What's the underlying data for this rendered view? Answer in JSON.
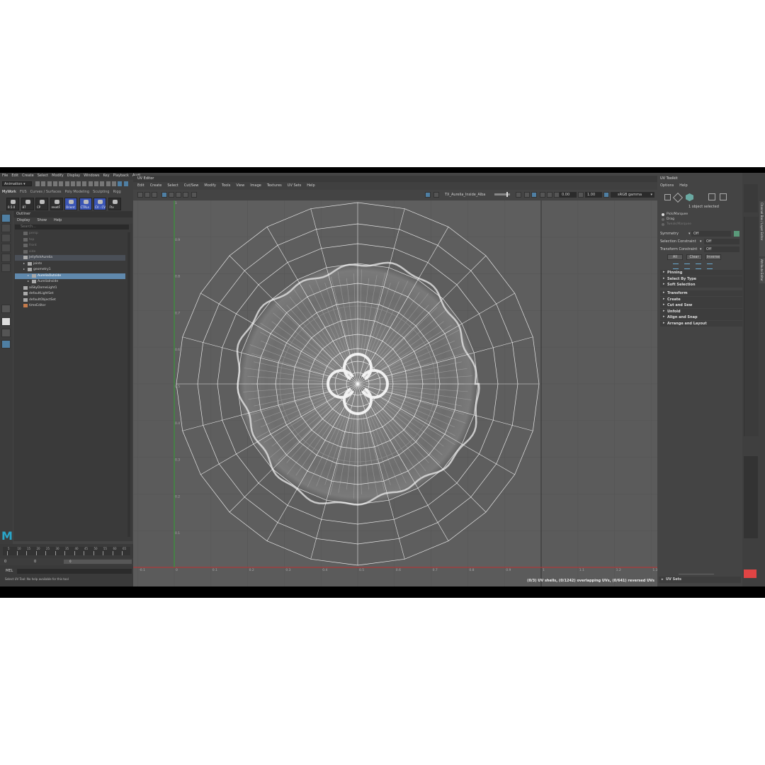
{
  "main_menu": [
    "File",
    "Edit",
    "Create",
    "Select",
    "Modify",
    "Display",
    "Windows",
    "Key",
    "Playback",
    "Audi"
  ],
  "mode_selector": "Animation",
  "shelf_tabs": [
    "MyWork",
    "FUS",
    "Curves / Surfaces",
    "Poly Modeling",
    "Sculpting",
    "Rigg"
  ],
  "shelf_labels": [
    "0.5.0",
    "87",
    "CP",
    "resetF",
    "Orient",
    "CTRLs",
    "CV - CV",
    "Ftv"
  ],
  "outliner": {
    "title": "Outliner",
    "menu": [
      "Display",
      "Show",
      "Help"
    ],
    "search_placeholder": "Search...",
    "rows": [
      {
        "label": "persp",
        "indent": 1,
        "selected": false,
        "dim": true
      },
      {
        "label": "top",
        "indent": 1,
        "selected": false,
        "dim": true
      },
      {
        "label": "front",
        "indent": 1,
        "selected": false,
        "dim": true
      },
      {
        "label": "side",
        "indent": 1,
        "selected": false,
        "dim": true
      },
      {
        "label": "JellyfishAurelia",
        "indent": 1,
        "selected": false,
        "dim": false,
        "highlight": true
      },
      {
        "label": "joints",
        "indent": 2,
        "selected": false,
        "dim": false
      },
      {
        "label": "geometry1",
        "indent": 2,
        "selected": false,
        "dim": false
      },
      {
        "label": "AureliaOutside",
        "indent": 3,
        "selected": true,
        "dim": false
      },
      {
        "label": "AureliaInside",
        "indent": 3,
        "selected": false,
        "dim": false
      },
      {
        "label": "aiSkyDomeLight1",
        "indent": 1,
        "selected": false,
        "dim": false
      },
      {
        "label": "defaultLightSet",
        "indent": 1,
        "selected": false,
        "dim": false
      },
      {
        "label": "defaultObjectSet",
        "indent": 1,
        "selected": false,
        "dim": false
      },
      {
        "label": "timeEditor",
        "indent": 1,
        "selected": false,
        "dim": false
      }
    ]
  },
  "timeline": {
    "frame_ticks": [
      "5",
      "10",
      "15",
      "20",
      "25",
      "30",
      "35",
      "40",
      "45",
      "50",
      "55",
      "60",
      "65"
    ],
    "range_start": "0",
    "range_end": "0",
    "anim_start": "0",
    "mel_label": "MEL",
    "status_text": "Select UV Tool: No help available for this tool"
  },
  "uv_editor": {
    "title": "UV Editor",
    "menu": [
      "Edit",
      "Create",
      "Select",
      "Cut/Sew",
      "Modify",
      "Tools",
      "View",
      "Image",
      "Textures",
      "UV Sets",
      "Help"
    ],
    "texture_name": "TX_Aurelia_Inside_Alba",
    "field_1": "0.00",
    "field_2": "1.00",
    "color_space": "sRGB gamma",
    "x_ticks": [
      "-0.1",
      "0",
      "0.1",
      "0.2",
      "0.3",
      "0.4",
      "0.5",
      "0.6",
      "0.7",
      "0.8",
      "0.9",
      "1",
      "1.1",
      "1.2",
      "1.3"
    ],
    "y_ticks": [
      "1",
      "0.9",
      "0.8",
      "0.7",
      "0.6",
      "0.5",
      "0.4",
      "0.3",
      "0.2",
      "0.1"
    ],
    "status": "(0/3) UV shells, (0/1242) overlapping UVs, (0/641) reversed UVs"
  },
  "uv_toolkit": {
    "title": "UV Toolkit",
    "menu": [
      "Options",
      "Help"
    ],
    "selected_text": "1 object selected",
    "select_modes": [
      "Pick/Marquee",
      "Drag",
      "Tweak/Marquee"
    ],
    "symmetry_label": "Symmetry",
    "symmetry_value": "Off",
    "selection_constraint_label": "Selection Constraint",
    "selection_constraint_value": "Off",
    "transform_constraint_label": "Transform Constraint",
    "transform_constraint_value": "Off",
    "buttons": [
      "All",
      "Clear",
      "Inverse"
    ],
    "sections_a": [
      "Pinning",
      "Select By Type",
      "Soft Selection"
    ],
    "sections_b": [
      "Transform",
      "Create",
      "Cut and Sew",
      "Unfold",
      "Align and Snap",
      "Arrange and Layout"
    ],
    "uv_sets": "UV Sets"
  },
  "side_tabs": [
    "Channel Box / Layer Editor",
    "Attribute Editor"
  ],
  "colors": {
    "accent": "#4f7fa3",
    "selection": "#6089ad",
    "maya_logo": "#29a6c9",
    "red_button": "#e04444"
  }
}
